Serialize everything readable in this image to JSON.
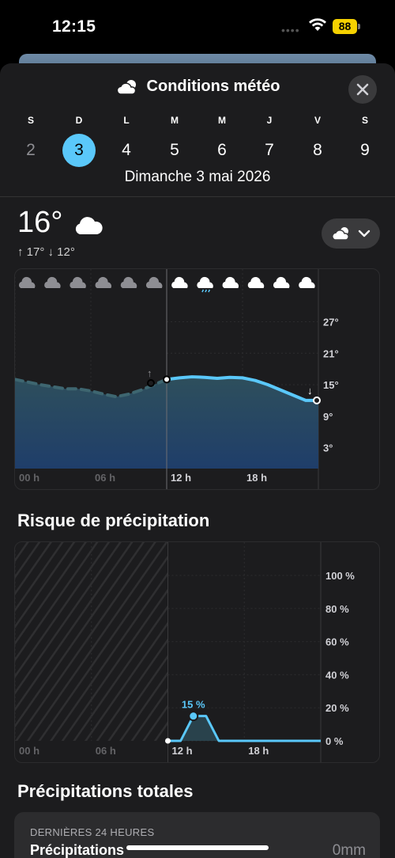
{
  "status": {
    "time": "12:15",
    "battery": "88"
  },
  "header": {
    "title": "Conditions météo",
    "icon": "cloud-sun-icon"
  },
  "week": {
    "days": [
      {
        "letter": "S",
        "num": "2",
        "state": "past"
      },
      {
        "letter": "D",
        "num": "3",
        "state": "selected"
      },
      {
        "letter": "L",
        "num": "4",
        "state": "future"
      },
      {
        "letter": "M",
        "num": "5",
        "state": "future"
      },
      {
        "letter": "M",
        "num": "6",
        "state": "future"
      },
      {
        "letter": "J",
        "num": "7",
        "state": "future"
      },
      {
        "letter": "V",
        "num": "8",
        "state": "future"
      },
      {
        "letter": "S",
        "num": "9",
        "state": "future"
      }
    ],
    "full_date": "Dimanche 3 mai 2026"
  },
  "current": {
    "temp": "16°",
    "hilo": "↑ 17° ↓ 12°"
  },
  "colors": {
    "accent": "#5ac8fa",
    "sheet": "#1c1c1e",
    "past_line": "#3e6670",
    "area_top": "#2e4f5c",
    "area_bottom": "#1f3e6a"
  },
  "chart_data": [
    {
      "type": "area",
      "x_ticks": [
        "00 h",
        "06 h",
        "12 h",
        "18 h"
      ],
      "y_ticks": [
        "27°",
        "21°",
        "15°",
        "9°",
        "3°"
      ],
      "ylim": [
        -1,
        31
      ],
      "now_hour": 12,
      "hourly_conditions": [
        "cloud",
        "cloud",
        "cloud",
        "cloud",
        "cloud",
        "cloud",
        "cloud",
        "cloud",
        "cloud",
        "cloud",
        "cloud",
        "cloud",
        "cloud",
        "cloud",
        "cloud",
        "cloud",
        "cloud",
        "cloud",
        "cloud",
        "cloud",
        "cloud",
        "cloud",
        "cloud",
        "cloud"
      ],
      "highlighted_condition": {
        "hour": 14,
        "icon": "cloud-drizzle-icon"
      },
      "series": [
        {
          "values": [
            16,
            15.5,
            15,
            14.6,
            14.2,
            14.2,
            13.8,
            13.2,
            12.7,
            13.2,
            14,
            15,
            16,
            16.3,
            16.5,
            16.4,
            16.2,
            16.4,
            16.3,
            15.8,
            15,
            14,
            13,
            12
          ]
        }
      ],
      "max_marker": {
        "hour": 11,
        "value": 17
      },
      "min_marker": {
        "hour": 23,
        "value": 12
      }
    },
    {
      "type": "area",
      "title": "Risque de précipitation",
      "x_ticks": [
        "00 h",
        "06 h",
        "12 h",
        "18 h"
      ],
      "y_ticks": [
        "100 %",
        "80 %",
        "60 %",
        "40 %",
        "20 %",
        "0 %"
      ],
      "ylim": [
        0,
        100
      ],
      "series": [
        {
          "values": [
            null,
            null,
            null,
            null,
            null,
            null,
            null,
            null,
            null,
            null,
            null,
            null,
            0,
            0,
            15,
            15,
            0,
            0,
            0,
            0,
            0,
            0,
            0,
            0
          ]
        }
      ],
      "peak_label": "15 %",
      "peak_hour": 14
    }
  ],
  "totals": {
    "title": "Précipitations totales",
    "label": "DERNIÈRES 24 HEURES",
    "name": "Précipitations",
    "value": "0mm"
  }
}
